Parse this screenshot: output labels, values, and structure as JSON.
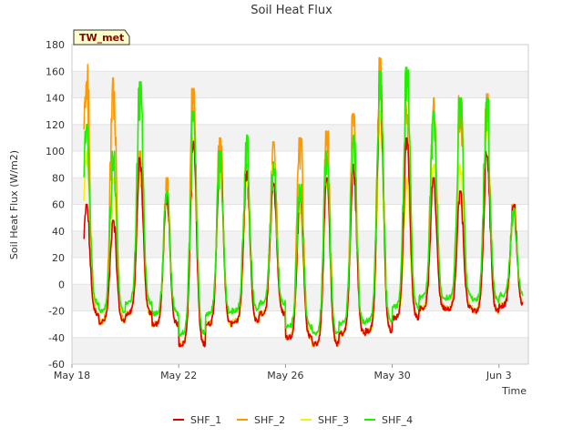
{
  "chart_data": {
    "type": "line",
    "title": "Soil Heat Flux",
    "xlabel": "Time",
    "ylabel": "Soil Heat Flux (W/m2)",
    "badge": "TW_met",
    "ylim": [
      -60,
      180
    ],
    "yticks": [
      -60,
      -40,
      -20,
      0,
      20,
      40,
      60,
      80,
      100,
      120,
      140,
      160,
      180
    ],
    "xlim_days": [
      0,
      17.1
    ],
    "xticks": [
      {
        "label": "May 18",
        "day": 0
      },
      {
        "label": "May 22",
        "day": 4
      },
      {
        "label": "May 26",
        "day": 8
      },
      {
        "label": "May 30",
        "day": 12
      },
      {
        "label": "Jun 3",
        "day": 16
      }
    ],
    "grid": true,
    "legend_position": "bottom",
    "colors": {
      "SHF_1": "#e00000",
      "SHF_2": "#ff9900",
      "SHF_3": "#ffee00",
      "SHF_4": "#22ee00",
      "band": "#f2f2f2",
      "axis": "#cccccc"
    },
    "daily_minimum": [
      -22,
      -28,
      -22,
      -30,
      -45,
      -30,
      -28,
      -22,
      -40,
      -45,
      -37,
      -35,
      -25,
      -18,
      -18,
      -20,
      -16
    ],
    "series": [
      {
        "name": "SHF_1",
        "start_day": 0.45,
        "daily_peak": [
          60,
          50,
          95,
          68,
          110,
          100,
          85,
          80,
          70,
          80,
          90,
          150,
          110,
          80,
          70,
          100,
          60
        ]
      },
      {
        "name": "SHF_2",
        "start_day": 0.45,
        "daily_peak": [
          165,
          155,
          100,
          80,
          147,
          110,
          90,
          107,
          110,
          115,
          128,
          170,
          140,
          140,
          143,
          143,
          60
        ]
      },
      {
        "name": "SHF_3",
        "start_day": 0.45,
        "daily_peak": [
          100,
          80,
          95,
          70,
          110,
          95,
          80,
          90,
          60,
          80,
          115,
          130,
          80,
          90,
          90,
          120,
          60
        ]
      },
      {
        "name": "SHF_4",
        "start_day": 0.45,
        "daily_peak": [
          120,
          100,
          152,
          70,
          130,
          100,
          112,
          92,
          75,
          100,
          112,
          160,
          163,
          130,
          140,
          140,
          60
        ]
      }
    ]
  }
}
